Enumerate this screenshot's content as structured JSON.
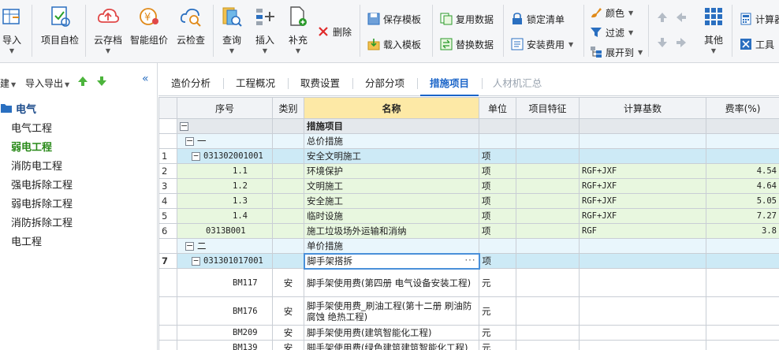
{
  "ribbon": {
    "import": "导入",
    "self_check": "项目自检",
    "cloud_save": "云存档",
    "smart_price": "智能组价",
    "cloud_check": "云检查",
    "query": "查询",
    "insert": "插入",
    "supplement": "补充",
    "delete": "删除",
    "save_template": "保存模板",
    "load_template": "载入模板",
    "reuse_data": "复用数据",
    "replace_data": "替换数据",
    "lock_list": "锁定清单",
    "install_fee": "安装费用",
    "color": "颜色",
    "filter": "过滤",
    "expand_to": "展开到",
    "other": "其他",
    "calc": "计算器",
    "tools": "工具"
  },
  "left_panel": {
    "new": "新建",
    "import_export": "导入导出",
    "root": "电气",
    "nodes": [
      "电气工程",
      "弱电工程",
      "消防电工程",
      "强电拆除工程",
      "弱电拆除工程",
      "消防拆除工程",
      "电工程"
    ]
  },
  "tabs": [
    "造价分析",
    "工程概况",
    "取费设置",
    "分部分项",
    "措施项目",
    "人材机汇总"
  ],
  "grid": {
    "headers": [
      "序号",
      "类别",
      "名称",
      "单位",
      "项目特征",
      "计算基数",
      "费率(%)"
    ],
    "rows": [
      {
        "no": "",
        "seq": "",
        "type": "",
        "name": "措施项目",
        "unit": "",
        "feature": "",
        "base": "",
        "rate": ""
      },
      {
        "no": "",
        "seq": "一",
        "type": "",
        "name": "总价措施",
        "unit": "",
        "feature": "",
        "base": "",
        "rate": ""
      },
      {
        "no": "1",
        "seq": "031302001001",
        "type": "",
        "name": "安全文明施工",
        "unit": "项",
        "feature": "",
        "base": "",
        "rate": ""
      },
      {
        "no": "2",
        "seq": "1.1",
        "type": "",
        "name": "环境保护",
        "unit": "项",
        "feature": "",
        "base": "RGF+JXF",
        "rate": "4.54"
      },
      {
        "no": "3",
        "seq": "1.2",
        "type": "",
        "name": "文明施工",
        "unit": "项",
        "feature": "",
        "base": "RGF+JXF",
        "rate": "4.64"
      },
      {
        "no": "4",
        "seq": "1.3",
        "type": "",
        "name": "安全施工",
        "unit": "项",
        "feature": "",
        "base": "RGF+JXF",
        "rate": "5.05"
      },
      {
        "no": "5",
        "seq": "1.4",
        "type": "",
        "name": "临时设施",
        "unit": "项",
        "feature": "",
        "base": "RGF+JXF",
        "rate": "7.27"
      },
      {
        "no": "6",
        "seq": "0313B001",
        "type": "",
        "name": "施工垃圾场外运输和消纳",
        "unit": "项",
        "feature": "",
        "base": "RGF",
        "rate": "3.8"
      },
      {
        "no": "",
        "seq": "二",
        "type": "",
        "name": "单价措施",
        "unit": "",
        "feature": "",
        "base": "",
        "rate": ""
      },
      {
        "no": "7",
        "seq": "031301017001",
        "type": "",
        "name": "脚手架搭拆",
        "unit": "项",
        "feature": "",
        "base": "",
        "rate": ""
      },
      {
        "no": "",
        "seq": "BM117",
        "type": "安",
        "name": "脚手架使用费(第四册 电气设备安装工程)",
        "unit": "元",
        "feature": "",
        "base": "",
        "rate": ""
      },
      {
        "no": "",
        "seq": "BM176",
        "type": "安",
        "name": "脚手架使用费_刷油工程(第十二册 刷油防腐蚀 绝热工程)",
        "unit": "元",
        "feature": "",
        "base": "",
        "rate": ""
      },
      {
        "no": "",
        "seq": "BM209",
        "type": "安",
        "name": "脚手架使用费(建筑智能化工程)",
        "unit": "元",
        "feature": "",
        "base": "",
        "rate": ""
      },
      {
        "no": "",
        "seq": "BM139",
        "type": "安",
        "name": "脚手架使用费(绿色建筑建筑智能化工程)",
        "unit": "元",
        "feature": "",
        "base": "",
        "rate": ""
      }
    ]
  }
}
